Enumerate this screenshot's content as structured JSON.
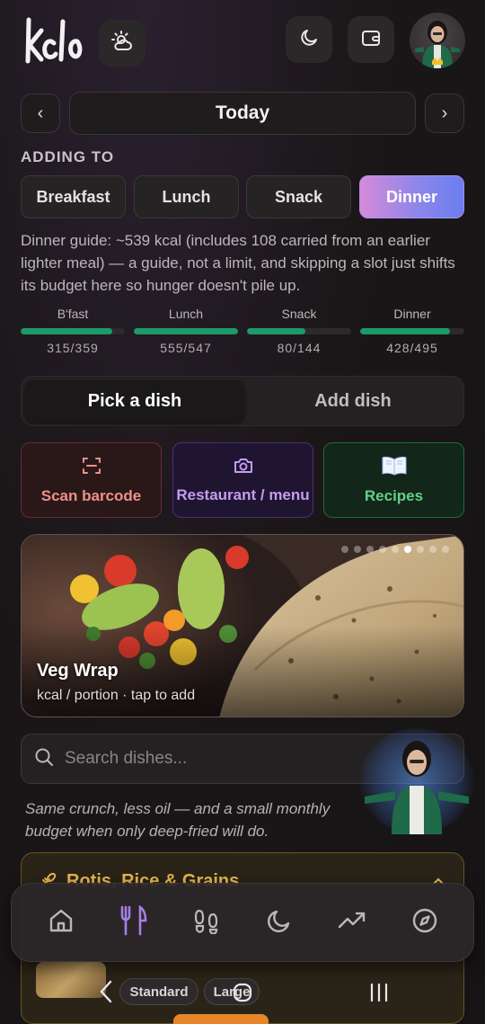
{
  "header": {
    "logo_text": "kclo",
    "icons": [
      "weather-icon",
      "moon-icon",
      "wallet-icon"
    ],
    "avatar_alt": "profile avatar"
  },
  "date_nav": {
    "prev": "‹",
    "label": "Today",
    "next": "›"
  },
  "adding_to": {
    "heading": "ADDING TO",
    "meals": [
      "Breakfast",
      "Lunch",
      "Snack",
      "Dinner"
    ],
    "selected": "Dinner"
  },
  "guide_text": "Dinner guide: ~539 kcal (includes 108 carried from an earlier lighter meal) — a guide, not a limit, and skipping a slot just shifts its budget here so hunger doesn't pile up.",
  "budgets": [
    {
      "label": "B'fast",
      "value": "315/359",
      "progress": 0.88
    },
    {
      "label": "Lunch",
      "value": "555/547",
      "progress": 1.0
    },
    {
      "label": "Snack",
      "value": "80/144",
      "progress": 0.56
    },
    {
      "label": "Dinner",
      "value": "428/495",
      "progress": 0.86
    }
  ],
  "mode_tabs": {
    "active": "Pick a dish",
    "inactive": "Add dish"
  },
  "actions": [
    {
      "label": "Scan barcode",
      "icon": "barcode-scan-icon",
      "color": "#ef8f8a"
    },
    {
      "label": "Restaurant / menu",
      "icon": "camera-icon",
      "color": "#c59cf2"
    },
    {
      "label": "Recipes",
      "icon": "book-icon",
      "color": "#62d088"
    }
  ],
  "hero": {
    "title": "Veg Wrap",
    "subtitle": "kcal / portion · tap to add",
    "dot_count": 9,
    "active_dot": 5
  },
  "search": {
    "placeholder": "Search dishes..."
  },
  "tip_text": "Same crunch, less oil — and a small monthly budget when only deep-fried will do.",
  "category": {
    "title": "Rotis, Rice & Grains"
  },
  "bottom_nav": [
    "home-icon",
    "fork-knife-icon",
    "footprints-icon",
    "moon-icon",
    "trending-up-icon",
    "compass-icon"
  ],
  "portion_chips": [
    "Standard",
    "Large"
  ],
  "colors": {
    "accent_purple": "#9b7ff0",
    "budget_green": "#1d9a69",
    "category_gold": "#e9b84e"
  }
}
